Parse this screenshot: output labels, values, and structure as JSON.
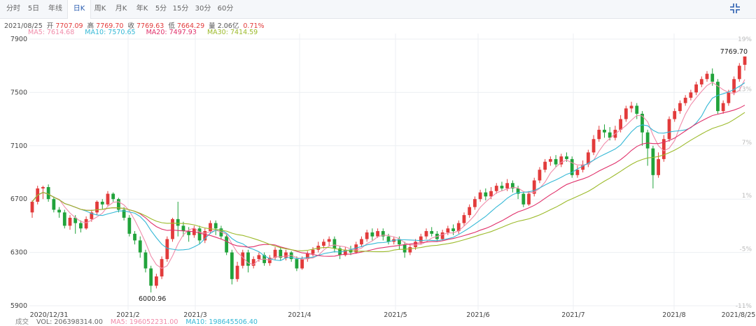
{
  "tabs": [
    {
      "label": "分时"
    },
    {
      "label": "5日"
    },
    {
      "label": "年线"
    },
    {
      "label": "日K"
    },
    {
      "label": "周K"
    },
    {
      "label": "月K"
    },
    {
      "label": "年K"
    },
    {
      "label": "5分"
    },
    {
      "label": "15分"
    },
    {
      "label": "30分"
    },
    {
      "label": "60分"
    }
  ],
  "active_tab": "日K",
  "icons": {
    "expand": "collapse-arrows-icon"
  },
  "info": {
    "date": "2021/08/25",
    "open_label": "开",
    "open": "7707.09",
    "high_label": "高",
    "high": "7769.70",
    "close_label": "收",
    "close": "7769.63",
    "low_label": "低",
    "low": "7664.29",
    "vol_label": "量",
    "vol": "2.06亿",
    "change": "0.71%"
  },
  "ma_legend": {
    "ma5": "MA5: 7614.68",
    "ma10": "MA10: 7570.65",
    "ma20": "MA20: 7497.93",
    "ma30": "MA30: 7414.59"
  },
  "volume_legend": {
    "label": "成交",
    "vol": "VOL: 206398314.00",
    "ma5": "MA5: 196052231.00",
    "ma10": "MA10: 198645506.40"
  },
  "colors": {
    "up": "#e23b3b",
    "down": "#21a33b",
    "ma5": "#f08caa",
    "ma10": "#34b8d6",
    "ma20": "#e0306a",
    "ma30": "#9cba2a",
    "grid": "#eceff3"
  },
  "chart_data": {
    "type": "candlestick",
    "ylim": [
      5900,
      7900
    ],
    "y_ticks": [
      7900,
      7500,
      7100,
      6700,
      6300,
      5900
    ],
    "right_ticks": [
      "19%",
      "13%",
      "7%",
      "1%",
      "-5%",
      "-11%"
    ],
    "x_labels": [
      "2020/12/31",
      "2021/2",
      "2021/3",
      "2021/4",
      "2021/5",
      "2021/6",
      "2021/7",
      "2021/8",
      "2021/8/25"
    ],
    "annotations": [
      {
        "text": "7769.70"
      },
      {
        "text": "6000.96"
      }
    ],
    "candles": [
      [
        6600,
        6680,
        6560,
        6690
      ],
      [
        6680,
        6780,
        6660,
        6800
      ],
      [
        6780,
        6790,
        6700,
        6800
      ],
      [
        6790,
        6700,
        6680,
        6810
      ],
      [
        6700,
        6620,
        6600,
        6720
      ],
      [
        6620,
        6600,
        6560,
        6640
      ],
      [
        6600,
        6500,
        6480,
        6620
      ],
      [
        6500,
        6560,
        6470,
        6580
      ],
      [
        6560,
        6520,
        6440,
        6580
      ],
      [
        6520,
        6480,
        6450,
        6540
      ],
      [
        6480,
        6550,
        6470,
        6570
      ],
      [
        6550,
        6600,
        6530,
        6620
      ],
      [
        6600,
        6680,
        6580,
        6690
      ],
      [
        6680,
        6660,
        6620,
        6700
      ],
      [
        6660,
        6740,
        6650,
        6760
      ],
      [
        6740,
        6700,
        6680,
        6750
      ],
      [
        6700,
        6620,
        6600,
        6710
      ],
      [
        6620,
        6560,
        6540,
        6640
      ],
      [
        6560,
        6440,
        6420,
        6580
      ],
      [
        6440,
        6390,
        6360,
        6460
      ],
      [
        6390,
        6300,
        6260,
        6420
      ],
      [
        6300,
        6180,
        6150,
        6320
      ],
      [
        6180,
        6050,
        6000,
        6200
      ],
      [
        6050,
        6120,
        6030,
        6140
      ],
      [
        6120,
        6250,
        6100,
        6270
      ],
      [
        6250,
        6400,
        6230,
        6420
      ],
      [
        6400,
        6550,
        6380,
        6560
      ],
      [
        6550,
        6500,
        6420,
        6680
      ],
      [
        6500,
        6460,
        6420,
        6530
      ],
      [
        6460,
        6430,
        6380,
        6490
      ],
      [
        6430,
        6480,
        6410,
        6500
      ],
      [
        6480,
        6390,
        6360,
        6500
      ],
      [
        6390,
        6460,
        6370,
        6480
      ],
      [
        6460,
        6520,
        6440,
        6540
      ],
      [
        6520,
        6480,
        6430,
        6540
      ],
      [
        6480,
        6420,
        6400,
        6500
      ],
      [
        6420,
        6300,
        6280,
        6440
      ],
      [
        6300,
        6100,
        6060,
        6320
      ],
      [
        6100,
        6200,
        6080,
        6230
      ],
      [
        6200,
        6300,
        6180,
        6320
      ],
      [
        6300,
        6200,
        6150,
        6320
      ],
      [
        6200,
        6250,
        6180,
        6270
      ],
      [
        6250,
        6280,
        6230,
        6300
      ],
      [
        6280,
        6220,
        6200,
        6300
      ],
      [
        6220,
        6260,
        6200,
        6280
      ],
      [
        6260,
        6320,
        6240,
        6340
      ],
      [
        6320,
        6260,
        6240,
        6340
      ],
      [
        6260,
        6300,
        6240,
        6320
      ],
      [
        6300,
        6250,
        6230,
        6310
      ],
      [
        6250,
        6180,
        6160,
        6270
      ],
      [
        6180,
        6250,
        6170,
        6270
      ],
      [
        6250,
        6290,
        6230,
        6310
      ],
      [
        6290,
        6320,
        6270,
        6340
      ],
      [
        6320,
        6350,
        6300,
        6380
      ],
      [
        6350,
        6380,
        6330,
        6400
      ],
      [
        6380,
        6400,
        6350,
        6420
      ],
      [
        6400,
        6330,
        6300,
        6420
      ],
      [
        6330,
        6280,
        6250,
        6350
      ],
      [
        6280,
        6320,
        6270,
        6340
      ],
      [
        6320,
        6300,
        6280,
        6350
      ],
      [
        6300,
        6360,
        6290,
        6380
      ],
      [
        6360,
        6400,
        6340,
        6420
      ],
      [
        6400,
        6450,
        6380,
        6470
      ],
      [
        6450,
        6420,
        6390,
        6480
      ],
      [
        6420,
        6460,
        6410,
        6480
      ],
      [
        6460,
        6420,
        6390,
        6480
      ],
      [
        6420,
        6380,
        6360,
        6440
      ],
      [
        6380,
        6400,
        6360,
        6420
      ],
      [
        6400,
        6360,
        6320,
        6420
      ],
      [
        6360,
        6300,
        6260,
        6380
      ],
      [
        6300,
        6340,
        6280,
        6360
      ],
      [
        6340,
        6380,
        6320,
        6400
      ],
      [
        6380,
        6420,
        6360,
        6440
      ],
      [
        6420,
        6460,
        6400,
        6480
      ],
      [
        6460,
        6440,
        6420,
        6490
      ],
      [
        6440,
        6400,
        6380,
        6460
      ],
      [
        6400,
        6450,
        6390,
        6470
      ],
      [
        6450,
        6480,
        6430,
        6500
      ],
      [
        6480,
        6460,
        6430,
        6510
      ],
      [
        6460,
        6520,
        6440,
        6540
      ],
      [
        6520,
        6580,
        6500,
        6600
      ],
      [
        6580,
        6640,
        6560,
        6660
      ],
      [
        6640,
        6700,
        6620,
        6720
      ],
      [
        6700,
        6750,
        6680,
        6770
      ],
      [
        6750,
        6720,
        6690,
        6780
      ],
      [
        6720,
        6760,
        6700,
        6790
      ],
      [
        6760,
        6800,
        6740,
        6820
      ],
      [
        6800,
        6780,
        6760,
        6830
      ],
      [
        6780,
        6820,
        6760,
        6850
      ],
      [
        6820,
        6780,
        6750,
        6840
      ],
      [
        6780,
        6740,
        6700,
        6800
      ],
      [
        6740,
        6660,
        6640,
        6760
      ],
      [
        6660,
        6740,
        6650,
        6760
      ],
      [
        6740,
        6840,
        6720,
        6860
      ],
      [
        6840,
        6920,
        6820,
        6940
      ],
      [
        6920,
        6980,
        6900,
        7000
      ],
      [
        6980,
        7000,
        6950,
        7020
      ],
      [
        7000,
        6960,
        6940,
        7030
      ],
      [
        6960,
        7020,
        6940,
        7040
      ],
      [
        7020,
        7000,
        6980,
        7050
      ],
      [
        7000,
        6880,
        6860,
        7020
      ],
      [
        6880,
        6920,
        6860,
        6950
      ],
      [
        6920,
        6960,
        6900,
        6990
      ],
      [
        6960,
        7050,
        6940,
        7070
      ],
      [
        7050,
        7150,
        7030,
        7180
      ],
      [
        7150,
        7220,
        7130,
        7250
      ],
      [
        7220,
        7200,
        7160,
        7260
      ],
      [
        7200,
        7160,
        7140,
        7240
      ],
      [
        7160,
        7220,
        7140,
        7250
      ],
      [
        7220,
        7300,
        7200,
        7330
      ],
      [
        7300,
        7380,
        7280,
        7400
      ],
      [
        7380,
        7400,
        7350,
        7430
      ],
      [
        7400,
        7340,
        7300,
        7420
      ],
      [
        7340,
        7200,
        7100,
        7360
      ],
      [
        7200,
        7080,
        6950,
        7220
      ],
      [
        7080,
        6880,
        6780,
        7100
      ],
      [
        6880,
        7000,
        6860,
        7050
      ],
      [
        7000,
        7150,
        6980,
        7180
      ],
      [
        7150,
        7300,
        7130,
        7320
      ],
      [
        7300,
        7360,
        7280,
        7380
      ],
      [
        7360,
        7420,
        7340,
        7440
      ],
      [
        7420,
        7460,
        7400,
        7480
      ],
      [
        7460,
        7500,
        7440,
        7520
      ],
      [
        7500,
        7560,
        7480,
        7580
      ],
      [
        7560,
        7600,
        7540,
        7620
      ],
      [
        7600,
        7640,
        7580,
        7660
      ],
      [
        7640,
        7580,
        7550,
        7680
      ],
      [
        7580,
        7360,
        7340,
        7600
      ],
      [
        7360,
        7420,
        7340,
        7440
      ],
      [
        7420,
        7500,
        7400,
        7520
      ],
      [
        7500,
        7600,
        7480,
        7620
      ],
      [
        7600,
        7700,
        7580,
        7720
      ],
      [
        7707.09,
        7769.63,
        7664.29,
        7769.7
      ]
    ]
  }
}
